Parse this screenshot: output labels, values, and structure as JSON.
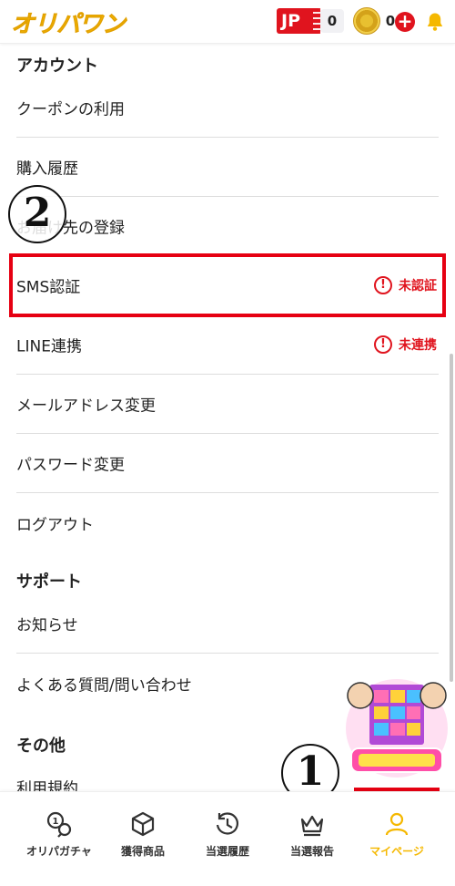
{
  "header": {
    "logo": "オリパワン",
    "jp_badge": "JP",
    "jp_count": "0",
    "coin_count": "0",
    "plus": "+"
  },
  "account": {
    "section_title": "アカウント",
    "items": [
      {
        "label": "クーポンの利用"
      },
      {
        "label": "購入履歴"
      },
      {
        "label": "お届け先の登録"
      },
      {
        "label": "SMS認証",
        "status": "未認証"
      },
      {
        "label": "LINE連携",
        "status": "未連携"
      },
      {
        "label": "メールアドレス変更"
      },
      {
        "label": "パスワード変更"
      },
      {
        "label": "ログアウト"
      }
    ]
  },
  "support": {
    "section_title": "サポート",
    "items": [
      {
        "label": "お知らせ"
      },
      {
        "label": "よくある質問/問い合わせ"
      }
    ]
  },
  "other": {
    "section_title": "その他",
    "items": [
      {
        "label": "利用規約"
      }
    ]
  },
  "annotations": {
    "step1": "1",
    "step2": "2"
  },
  "bottom_nav": [
    {
      "label": "オリパガチャ",
      "icon": "gacha-icon"
    },
    {
      "label": "獲得商品",
      "icon": "box-icon"
    },
    {
      "label": "当選履歴",
      "icon": "history-icon"
    },
    {
      "label": "当選報告",
      "icon": "crown-icon"
    },
    {
      "label": "マイページ",
      "icon": "user-icon",
      "active": true
    }
  ],
  "colors": {
    "brand_yellow": "#f5b800",
    "alert_red": "#e0141e",
    "annotation_red": "#e60012"
  }
}
